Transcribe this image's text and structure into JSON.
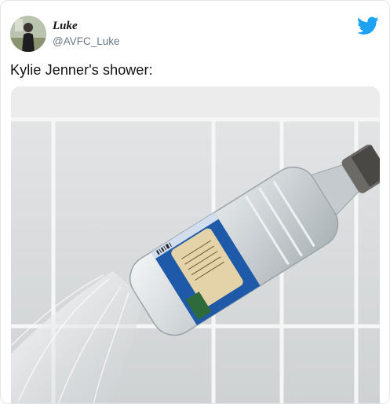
{
  "tweet": {
    "author_name": "Luke",
    "author_handle": "@AVFC_Luke",
    "text": "Kylie Jenner's shower:",
    "icons": {
      "logo": "twitter-bird-icon",
      "avatar": "profile-photo"
    },
    "colors": {
      "twitter_blue": "#1da1f2",
      "handle_gray": "#6a7785"
    }
  }
}
